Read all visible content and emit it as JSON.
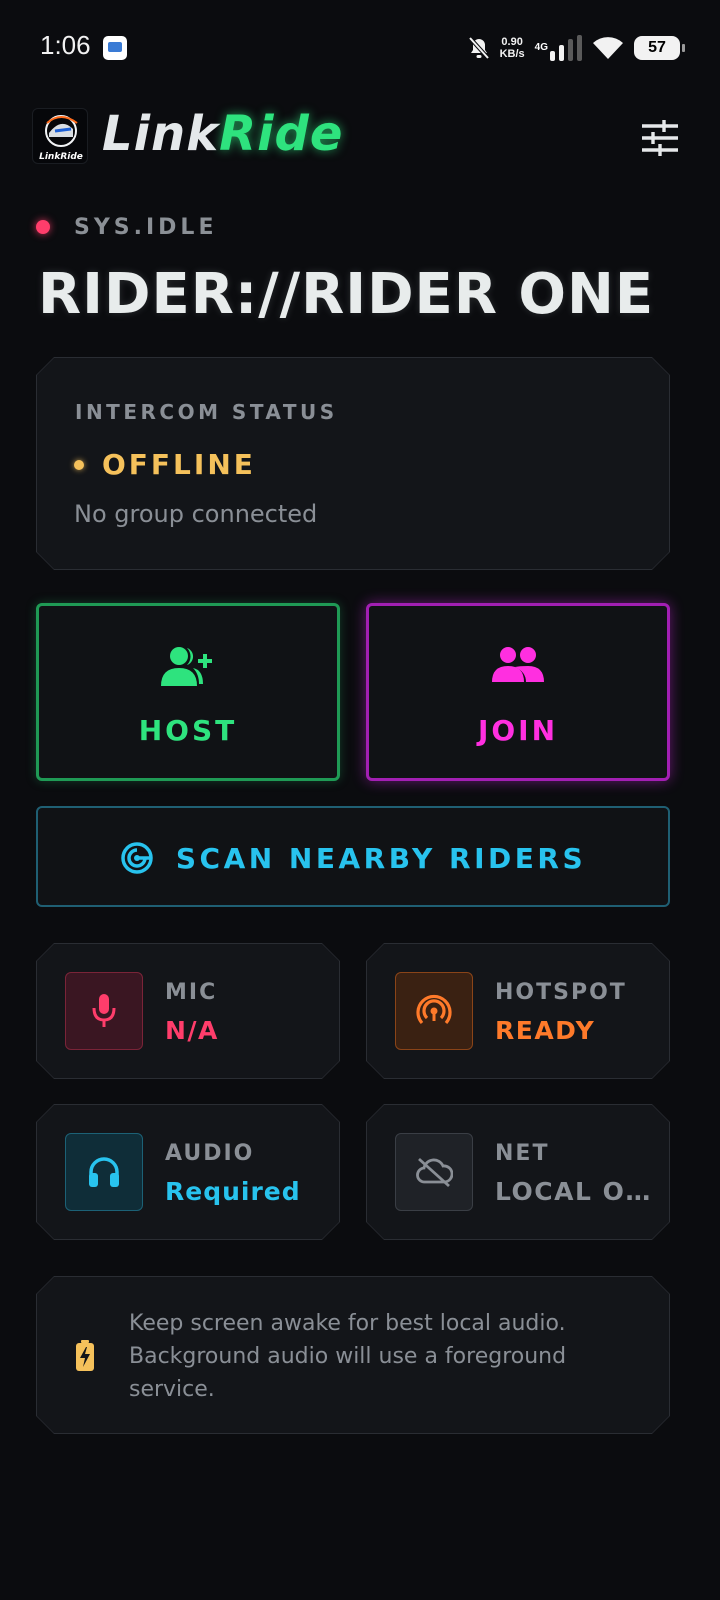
{
  "status_bar": {
    "time": "1:06",
    "speed_value": "0.90",
    "speed_unit": "KB/s",
    "network_type": "4G",
    "battery": "57"
  },
  "app": {
    "logo_caption": "LinkRide",
    "name_part1": "Link",
    "name_part2": "Ride",
    "accent_color": "#2ee37e"
  },
  "header": {
    "sys_state": "SYS.IDLE",
    "rider_title": "RIDER://RIDER ONE"
  },
  "intercom": {
    "label": "INTERCOM STATUS",
    "state": "OFFLINE",
    "detail": "No group connected"
  },
  "actions": {
    "host_label": "HOST",
    "join_label": "JOIN",
    "scan_label": "SCAN NEARBY RIDERS"
  },
  "stats": [
    {
      "label": "MIC",
      "value": "N/A",
      "icon": "mic-icon",
      "color": "#ff3d6b"
    },
    {
      "label": "HOTSPOT",
      "value": "READY",
      "icon": "hotspot-icon",
      "color": "#ff7a2a"
    },
    {
      "label": "AUDIO",
      "value": "Required",
      "icon": "headphones-icon",
      "color": "#28c3ee"
    },
    {
      "label": "NET",
      "value": "LOCAL O…",
      "icon": "cloud-off-icon",
      "color": "#8a8f96"
    }
  ],
  "tip": {
    "text": "Keep screen awake for best local audio. Background audio will use a foreground service.",
    "icon": "battery-charging-icon"
  }
}
